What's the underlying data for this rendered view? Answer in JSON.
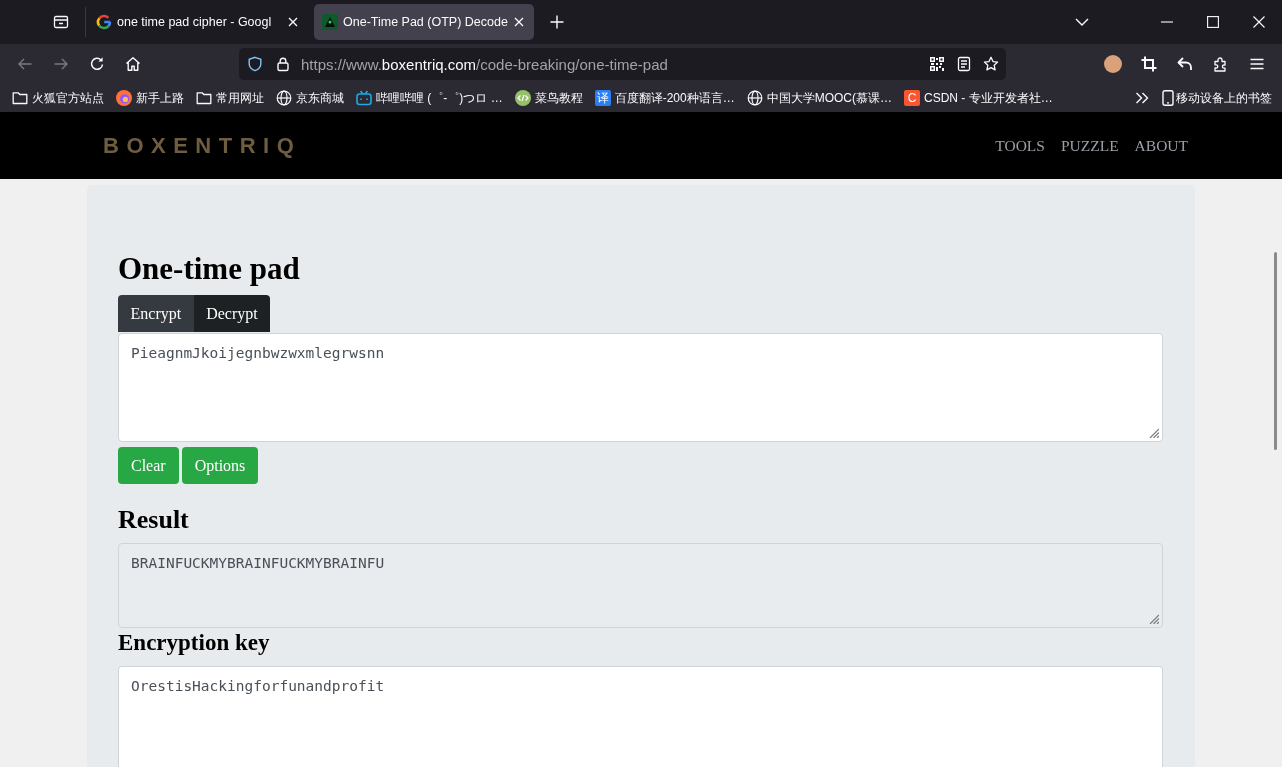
{
  "browser": {
    "tabs": [
      {
        "title": "one time pad cipher - Googl",
        "kind": "search",
        "selected": false
      },
      {
        "title": "One-Time Pad (OTP) Decode",
        "kind": "page",
        "selected": true
      }
    ],
    "nav_buttons": [
      {
        "kind": "back",
        "disabled": true
      },
      {
        "kind": "forward",
        "disabled": true
      },
      {
        "kind": "reload",
        "disabled": false
      },
      {
        "kind": "home",
        "disabled": false
      }
    ],
    "address": {
      "prefix": "https://www.",
      "domain": "boxentriq.com",
      "path": "/code-breaking/one-time-pad"
    },
    "bookmarks": [
      {
        "label": "火狐官方站点",
        "kind": "folder"
      },
      {
        "label": "新手上路",
        "kind": "browser"
      },
      {
        "label": "常用网址",
        "kind": "folder"
      },
      {
        "label": "京东商城",
        "kind": "globe"
      },
      {
        "label": "哔哩哔哩 (゜-゜)つロ …",
        "kind": "tv"
      },
      {
        "label": "菜鸟教程",
        "kind": "code"
      },
      {
        "label": "百度翻译-200种语言…",
        "kind": "badge",
        "glyph": "译",
        "color": "#2a7ff3"
      },
      {
        "label": "中国大学MOOC(慕课…",
        "kind": "globe"
      },
      {
        "label": "CSDN - 专业开发者社…",
        "kind": "badge",
        "glyph": "C",
        "color": "#fc5531"
      }
    ],
    "mobile_bookmarks": "移动设备上的书签"
  },
  "site": {
    "logo": "BOXENTRIQ",
    "nav": [
      "TOOLS",
      "PUZZLE",
      "ABOUT"
    ]
  },
  "page": {
    "title": "One-time pad",
    "modes": [
      {
        "label": "Encrypt",
        "selected": false
      },
      {
        "label": "Decrypt",
        "selected": true
      }
    ],
    "input": "PieagnmJkoijegnbwzwxmlegrwsnn",
    "clear_button": "Clear",
    "options_button": "Options",
    "result_heading": "Result",
    "result": "BRAINFUCKMYBRAINFUCKMYBRAINFU",
    "key_heading": "Encryption key",
    "key": "OrestisHackingforfunandprofit"
  }
}
